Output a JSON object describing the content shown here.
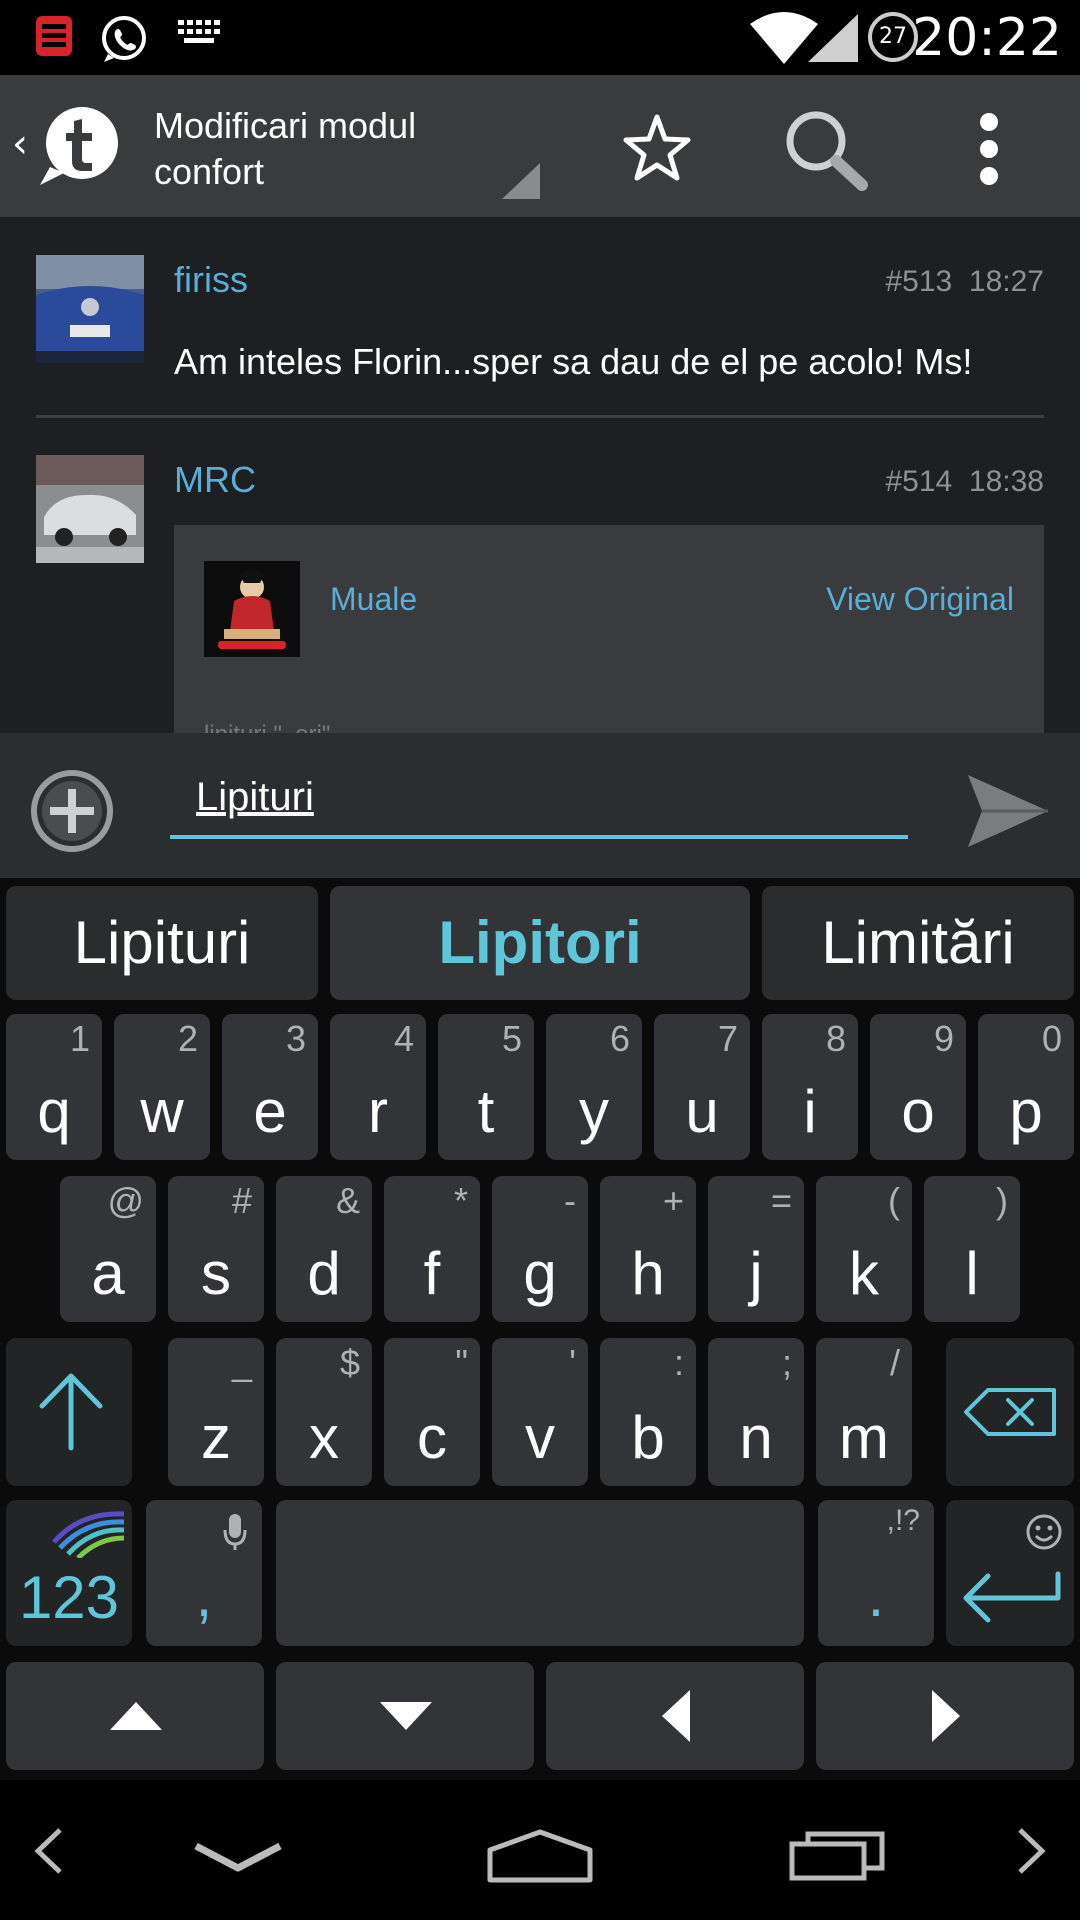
{
  "status_bar": {
    "time": "20:22",
    "battery_level": "27",
    "icons": [
      "app-icon",
      "whatsapp-icon",
      "keyboard-icon",
      "wifi-icon",
      "signal-icon"
    ]
  },
  "app_bar": {
    "title": "Modificari modul confort",
    "icons": [
      "back-chevron-icon",
      "tapatalk-logo-icon",
      "star-icon",
      "search-icon",
      "more-vertical-icon"
    ]
  },
  "posts": [
    {
      "author": "firiss",
      "number": "#513",
      "time": "18:27",
      "text": "Am inteles Florin...sper sa dau de el pe acolo! Ms!"
    },
    {
      "author": "MRC",
      "number": "#514",
      "time": "18:38",
      "quote": {
        "author": "Muale",
        "link": "View Original",
        "snippet": "lipituri \"..ori\""
      }
    }
  ],
  "compose": {
    "value": "Lipituri"
  },
  "keyboard": {
    "suggestions": [
      "Lipituri",
      "Lipitori",
      "Limitări"
    ],
    "row1": [
      {
        "main": "q",
        "sec": "1"
      },
      {
        "main": "w",
        "sec": "2"
      },
      {
        "main": "e",
        "sec": "3"
      },
      {
        "main": "r",
        "sec": "4"
      },
      {
        "main": "t",
        "sec": "5"
      },
      {
        "main": "y",
        "sec": "6"
      },
      {
        "main": "u",
        "sec": "7"
      },
      {
        "main": "i",
        "sec": "8"
      },
      {
        "main": "o",
        "sec": "9"
      },
      {
        "main": "p",
        "sec": "0"
      }
    ],
    "row2": [
      {
        "main": "a",
        "sec": "@"
      },
      {
        "main": "s",
        "sec": "#"
      },
      {
        "main": "d",
        "sec": "&"
      },
      {
        "main": "f",
        "sec": "*"
      },
      {
        "main": "g",
        "sec": "-"
      },
      {
        "main": "h",
        "sec": "+"
      },
      {
        "main": "j",
        "sec": "="
      },
      {
        "main": "k",
        "sec": "("
      },
      {
        "main": "l",
        "sec": ")"
      }
    ],
    "row3": [
      {
        "main": "z",
        "sec": "_"
      },
      {
        "main": "x",
        "sec": "$"
      },
      {
        "main": "c",
        "sec": "\""
      },
      {
        "main": "v",
        "sec": "'"
      },
      {
        "main": "b",
        "sec": ":"
      },
      {
        "main": "n",
        "sec": ";"
      },
      {
        "main": "m",
        "sec": "/"
      }
    ],
    "numbers_label": "123",
    "comma": ",",
    "period": ".",
    "period_sec": ",!?"
  },
  "colors": {
    "accent": "#5ec6d8",
    "link": "#5aaed6"
  }
}
